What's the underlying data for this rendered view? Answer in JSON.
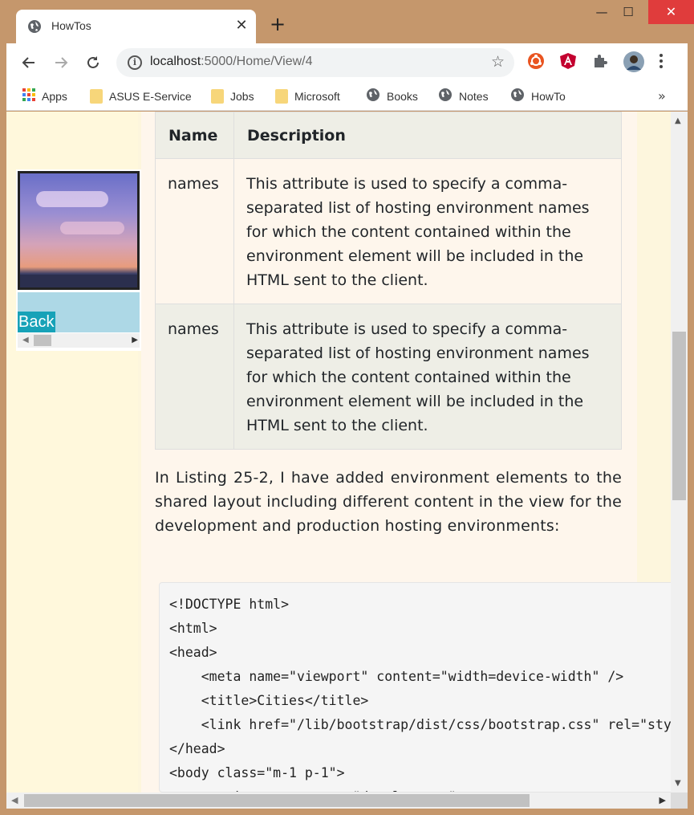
{
  "browser": {
    "tab_title": "HowTos",
    "tab_close": "✕",
    "new_tab": "+",
    "url_host": "localhost",
    "url_path": ":5000/Home/View/4",
    "window_controls": {
      "minimize": "—",
      "maximize": "☐",
      "close": "✕"
    }
  },
  "bookmarks": [
    {
      "label": "Apps",
      "icon": "apps-grid-icon"
    },
    {
      "label": "ASUS E-Service",
      "icon": "folder-icon"
    },
    {
      "label": "Jobs",
      "icon": "folder-icon"
    },
    {
      "label": "Microsoft",
      "icon": "folder-icon"
    },
    {
      "label": "Books",
      "icon": "globe-icon"
    },
    {
      "label": "Notes",
      "icon": "globe-icon"
    },
    {
      "label": "HowTo",
      "icon": "globe-icon"
    }
  ],
  "bookmarks_more": "»",
  "sidebar": {
    "back_label": "Back"
  },
  "table": {
    "headers": [
      "Name",
      "Description"
    ],
    "rows": [
      {
        "name": "names",
        "description": "This attribute is used to specify a comma-separated list of hosting environment names for which the content contained within the environment element will be included in the HTML sent to the client."
      },
      {
        "name": "names",
        "description": "This attribute is used to specify a comma-separated list of hosting environment names for which the content contained within the environment element will be included in the HTML sent to the client."
      }
    ]
  },
  "paragraph": "In Listing 25-2, I have added environment elements to the shared layout including different content in the view for the development and production hosting environments:",
  "code_lines": [
    "<!DOCTYPE html>",
    "<html>",
    "<head>",
    "    <meta name=\"viewport\" content=\"width=device-width\" />",
    "    <title>Cities</title>",
    "    <link href=\"/lib/bootstrap/dist/css/bootstrap.css\" rel=\"stylesheet\" />",
    "</head>",
    "<body class=\"m-1 p-1\">",
    "    <environment names=\"development\">"
  ]
}
